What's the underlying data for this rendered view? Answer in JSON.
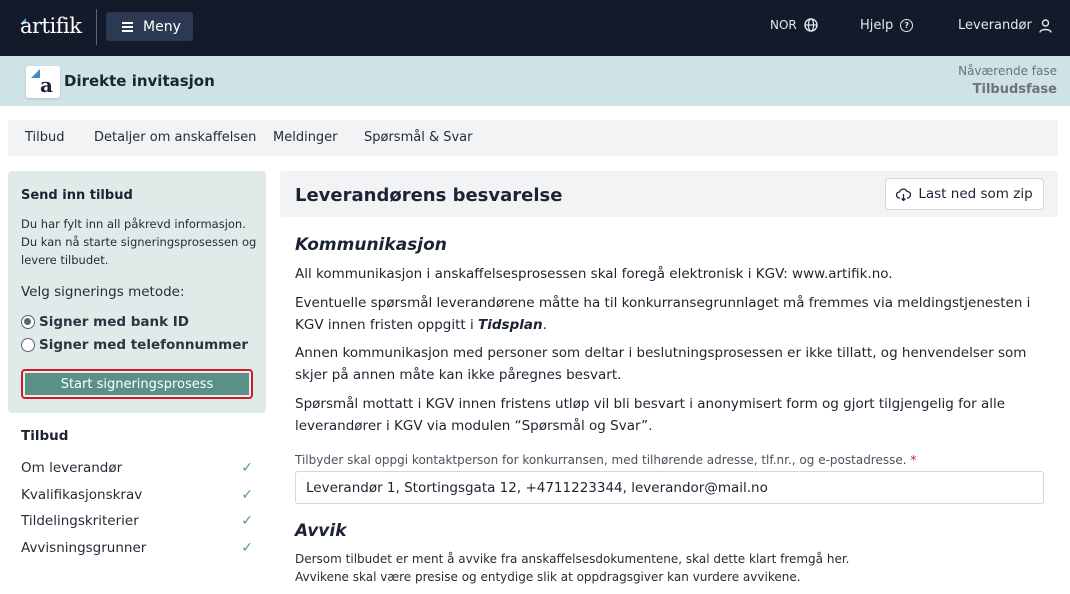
{
  "topbar": {
    "logo_text": "artifik",
    "menu_label": "Meny",
    "lang_label": "NOR",
    "help_label": "Hjelp",
    "user_label": "Leverandør"
  },
  "subheader": {
    "badge_letter": "a",
    "title": "Direkte invitasjon",
    "phase_label": "Nåværende fase",
    "phase_value": "Tilbudsfase"
  },
  "tabs": [
    "Tilbud",
    "Detaljer om anskaffelsen",
    "Meldinger",
    "Spørsmål & Svar"
  ],
  "sidebar": {
    "card_title": "Send inn tilbud",
    "card_desc": "Du har fylt inn all påkrevd informasjon. Du kan nå starte signeringsprosessen og levere tilbudet.",
    "method_label": "Velg signerings metode:",
    "options": [
      "Signer med bank ID",
      "Signer med telefonnummer"
    ],
    "selected_option": "Signer med bank ID",
    "start_button": "Start signeringsprosess",
    "section_title": "Tilbud",
    "items": [
      "Om leverandør",
      "Kvalifikasjonskrav",
      "Tildelingskriterier",
      "Avvisningsgrunner"
    ]
  },
  "main": {
    "title": "Leverandørens besvarelse",
    "zip_button": "Last ned som zip",
    "kommunikasjon": {
      "heading": "Kommunikasjon",
      "p1": "All kommunikasjon i anskaffelsesprosessen skal foregå elektronisk i KGV: www.artifik.no.",
      "p2_start": "Eventuelle spørsmål leverandørene måtte ha til konkurransegrunnlaget må fremmes via  meldingstjenesten i KGV innen fristen oppgitt i ",
      "p2_link": "Tidsplan",
      "p2_end": ".",
      "p3": "Annen kommunikasjon med personer som  deltar i beslutningsprosessen er ikke tillatt, og henvendelser som skjer på annen måte kan ikke  påregnes besvart.",
      "p4": "Spørsmål mottatt i KGV innen fristens utløp vil bli besvart i anonymisert form og gjort tilgjengelig for  alle leverandører i KGV via modulen “Spørsmål og Svar”.",
      "field_label": "Tilbyder skal oppgi kontaktperson for konkurransen, med tilhørende  adresse, tlf.nr., og e-postadresse.",
      "field_required": "*",
      "field_value": "Leverandør 1, Stortingsgata 12, +4711223344, leverandor@mail.no"
    },
    "avvik": {
      "heading": "Avvik",
      "line1": "Dersom tilbudet er ment å avvike fra anskaffelsesdokumentene, skal dette klart fremgå her.",
      "line2": "Avvikene skal være presise og entydige slik at oppdragsgiver kan vurdere avvikene."
    }
  }
}
